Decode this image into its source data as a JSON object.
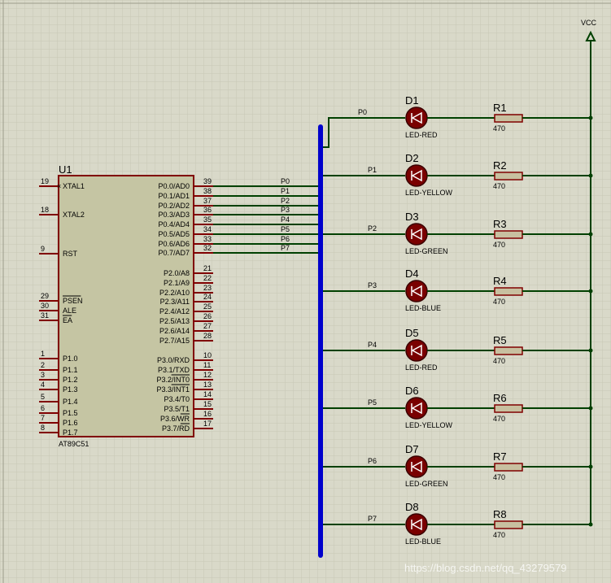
{
  "vcc_label": "VCC",
  "mcu": {
    "ref": "U1",
    "part": "AT89C51",
    "left_pins": [
      {
        "num": "19",
        "name": "XTAL1"
      },
      {
        "num": "18",
        "name": "XTAL2"
      },
      {
        "num": "9",
        "name": "RST"
      },
      {
        "num": "29",
        "name": "PSEN"
      },
      {
        "num": "30",
        "name": "ALE"
      },
      {
        "num": "31",
        "name": "EA"
      },
      {
        "num": "1",
        "name": "P1.0"
      },
      {
        "num": "2",
        "name": "P1.1"
      },
      {
        "num": "3",
        "name": "P1.2"
      },
      {
        "num": "4",
        "name": "P1.3"
      },
      {
        "num": "5",
        "name": "P1.4"
      },
      {
        "num": "6",
        "name": "P1.5"
      },
      {
        "num": "7",
        "name": "P1.6"
      },
      {
        "num": "8",
        "name": "P1.7"
      }
    ],
    "right_pins": [
      {
        "num": "39",
        "name": "P0.0/AD0"
      },
      {
        "num": "38",
        "name": "P0.1/AD1"
      },
      {
        "num": "37",
        "name": "P0.2/AD2"
      },
      {
        "num": "36",
        "name": "P0.3/AD3"
      },
      {
        "num": "35",
        "name": "P0.4/AD4"
      },
      {
        "num": "34",
        "name": "P0.5/AD5"
      },
      {
        "num": "33",
        "name": "P0.6/AD6"
      },
      {
        "num": "32",
        "name": "P0.7/AD7"
      },
      {
        "num": "21",
        "name": "P2.0/A8"
      },
      {
        "num": "22",
        "name": "P2.1/A9"
      },
      {
        "num": "23",
        "name": "P2.2/A10"
      },
      {
        "num": "24",
        "name": "P2.3/A11"
      },
      {
        "num": "25",
        "name": "P2.4/A12"
      },
      {
        "num": "26",
        "name": "P2.5/A13"
      },
      {
        "num": "27",
        "name": "P2.6/A14"
      },
      {
        "num": "28",
        "name": "P2.7/A15"
      },
      {
        "num": "10",
        "name": "P3.0/RXD"
      },
      {
        "num": "11",
        "name": "P3.1/TXD"
      },
      {
        "num": "12",
        "name": "P3.2/INT0"
      },
      {
        "num": "13",
        "name": "P3.3/INT1"
      },
      {
        "num": "14",
        "name": "P3.4/T0"
      },
      {
        "num": "15",
        "name": "P3.5/T1"
      },
      {
        "num": "16",
        "name": "P3.6/WR"
      },
      {
        "num": "17",
        "name": "P3.7/RD"
      }
    ]
  },
  "bus_labels": [
    "P0",
    "P1",
    "P2",
    "P3",
    "P4",
    "P5",
    "P6",
    "P7"
  ],
  "channels": [
    {
      "net": "P0",
      "led_ref": "D1",
      "led_type": "LED-RED",
      "res_ref": "R1",
      "res_value": "470"
    },
    {
      "net": "P1",
      "led_ref": "D2",
      "led_type": "LED-YELLOW",
      "res_ref": "R2",
      "res_value": "470"
    },
    {
      "net": "P2",
      "led_ref": "D3",
      "led_type": "LED-GREEN",
      "res_ref": "R3",
      "res_value": "470"
    },
    {
      "net": "P3",
      "led_ref": "D4",
      "led_type": "LED-BLUE",
      "res_ref": "R4",
      "res_value": "470"
    },
    {
      "net": "P4",
      "led_ref": "D5",
      "led_type": "LED-RED",
      "res_ref": "R5",
      "res_value": "470"
    },
    {
      "net": "P5",
      "led_ref": "D6",
      "led_type": "LED-YELLOW",
      "res_ref": "R6",
      "res_value": "470"
    },
    {
      "net": "P6",
      "led_ref": "D7",
      "led_type": "LED-GREEN",
      "res_ref": "R7",
      "res_value": "470"
    },
    {
      "net": "P7",
      "led_ref": "D8",
      "led_type": "LED-BLUE",
      "res_ref": "R8",
      "res_value": "470"
    }
  ],
  "watermark": "https://blog.csdn.net/qq_43279579",
  "colors": {
    "background": "#d9d9c9",
    "grid": "#c7c7b5",
    "wire": "#004000",
    "bus": "#0000cc",
    "chip_body": "#c5c5a3",
    "chip_border": "#800000",
    "led_fill": "#7a0000",
    "resistor_fill": "#c8c0a0",
    "vcc_symbol": "#004000"
  }
}
